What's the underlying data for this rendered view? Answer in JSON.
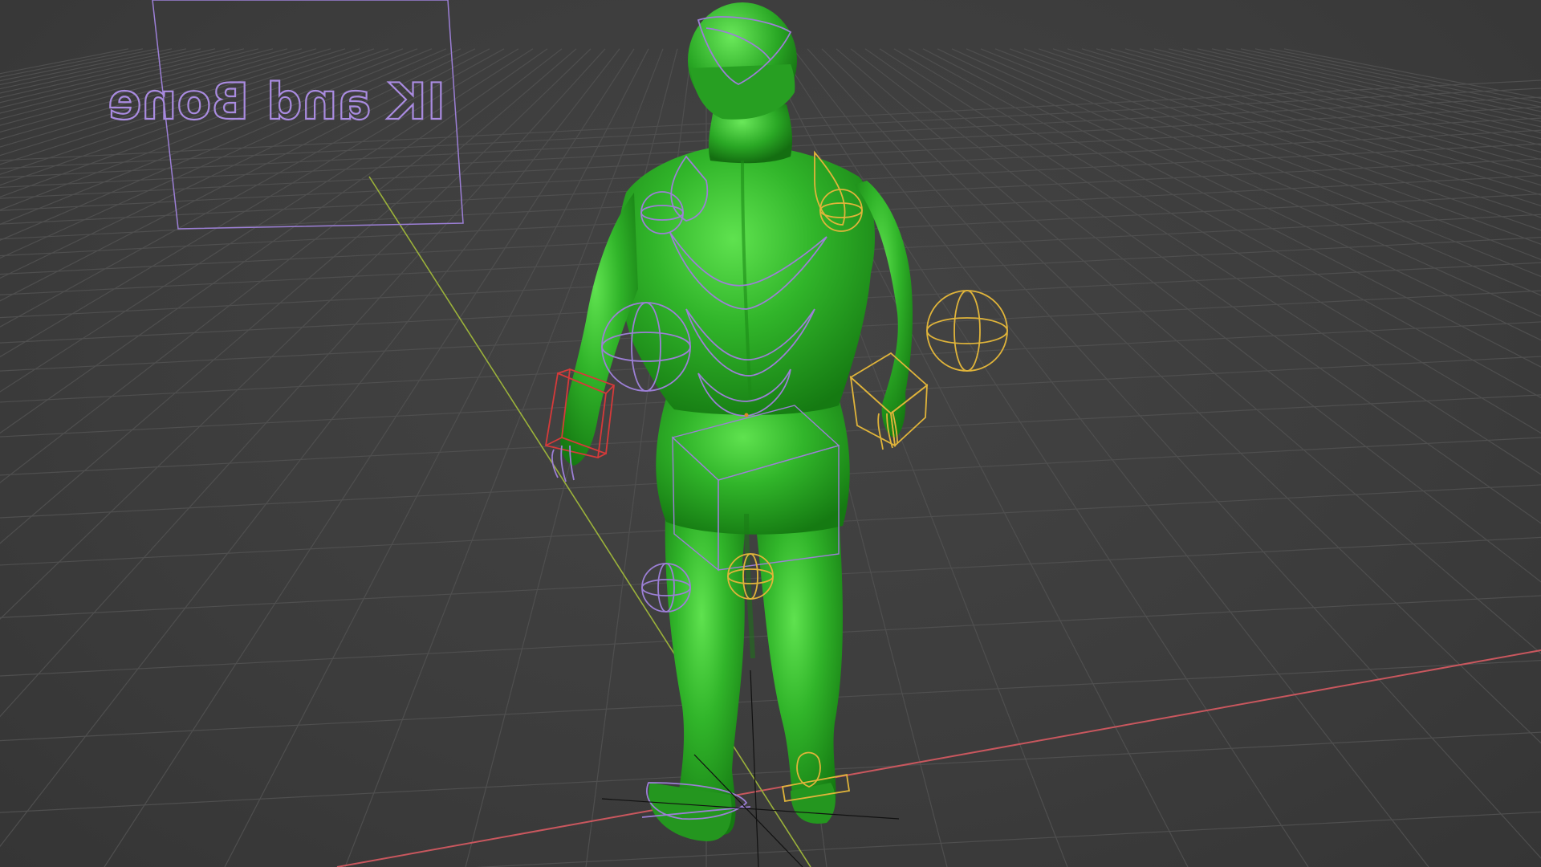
{
  "viewport": {
    "label_text": "IK and Bone",
    "background_color": "#3d3d3d",
    "grid_color": "#4e4e4e",
    "x_axis_color": "#c9575e",
    "y_axis_color": "#9bb23a",
    "character_color": "#2fb82a",
    "rig_selected_color": "#e0b43a",
    "rig_default_color": "#9c7fd6",
    "rig_active_color": "#d63a3a"
  },
  "character": {
    "name_icon": "army-man-figure"
  }
}
